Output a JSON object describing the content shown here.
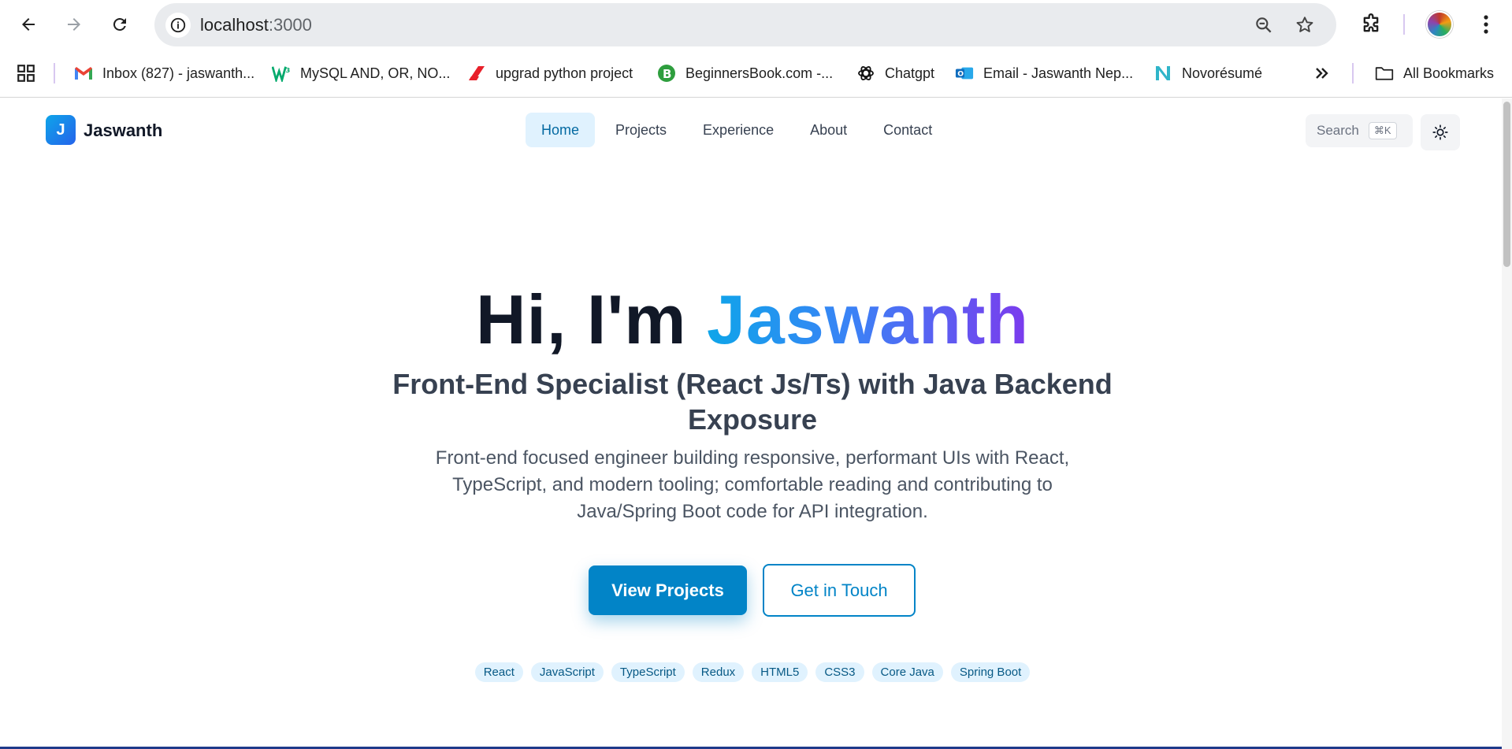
{
  "browser": {
    "url_host": "localhost",
    "url_port": ":3000",
    "bookmarks": [
      {
        "label": "Inbox (827) - jaswanth...",
        "icon": "gmail-icon",
        "color": "#ea4335"
      },
      {
        "label": "MySQL AND, OR, NO...",
        "icon": "w3schools-icon",
        "color": "#04aa6d"
      },
      {
        "label": "upgrad python project",
        "icon": "upgrad-icon",
        "color": "#e8202a"
      },
      {
        "label": "BeginnersBook.com -...",
        "icon": "beginnersbook-icon",
        "color": "#2e9e3e"
      },
      {
        "label": "Chatgpt",
        "icon": "chatgpt-icon",
        "color": "#000000"
      },
      {
        "label": "Email - Jaswanth Nep...",
        "icon": "outlook-icon",
        "color": "#0f6cbd"
      },
      {
        "label": "Novorésumé",
        "icon": "novoresume-icon",
        "color": "#2fb5c9"
      }
    ],
    "all_bookmarks_label": "All Bookmarks"
  },
  "site": {
    "logo_letter": "J",
    "logo_text": "Jaswanth",
    "nav": [
      {
        "label": "Home",
        "active": true
      },
      {
        "label": "Projects",
        "active": false
      },
      {
        "label": "Experience",
        "active": false
      },
      {
        "label": "About",
        "active": false
      },
      {
        "label": "Contact",
        "active": false
      }
    ],
    "search_label": "Search",
    "search_shortcut": "⌘K"
  },
  "hero": {
    "greeting": "Hi, I'm ",
    "name": "Jaswanth",
    "subtitle": "Front-End Specialist (React Js/Ts) with Java Backend Exposure",
    "description": "Front-end focused engineer building responsive, performant UIs with React, TypeScript, and modern tooling; comfortable reading and contributing to Java/Spring Boot code for API integration.",
    "primary_cta": "View Projects",
    "secondary_cta": "Get in Touch",
    "skills": [
      "React",
      "JavaScript",
      "TypeScript",
      "Redux",
      "HTML5",
      "CSS3",
      "Core Java",
      "Spring Boot"
    ]
  },
  "colors": {
    "accent": "#0284c7",
    "gradient_start": "#0ea5e9",
    "gradient_end": "#7c3aed",
    "chip_bg": "#e0f2fe"
  }
}
